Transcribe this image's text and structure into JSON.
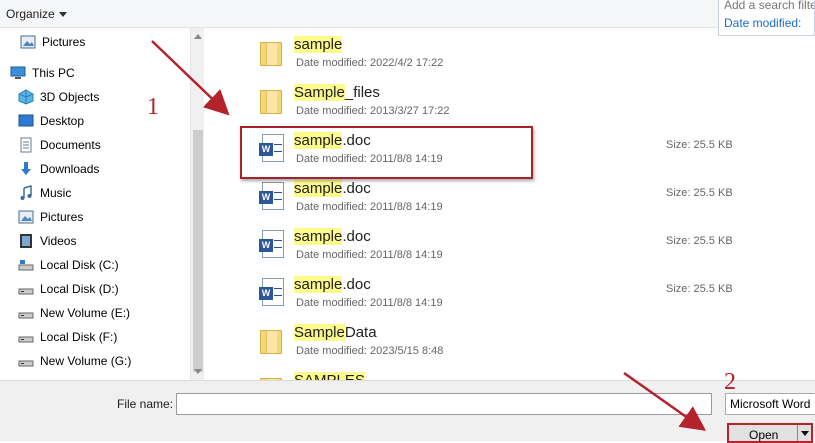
{
  "toolbar": {
    "organize_label": "Organize"
  },
  "search_dropdown": {
    "hint": "Add a search filte",
    "filter_label": "Date modified:"
  },
  "nav": {
    "items": [
      {
        "label": "Pictures",
        "icon": "pictures-icon"
      },
      {
        "label": "This PC",
        "icon": "computer-icon"
      },
      {
        "label": "3D Objects",
        "icon": "3d-objects-icon"
      },
      {
        "label": "Desktop",
        "icon": "desktop-icon"
      },
      {
        "label": "Documents",
        "icon": "documents-icon"
      },
      {
        "label": "Downloads",
        "icon": "downloads-icon"
      },
      {
        "label": "Music",
        "icon": "music-icon"
      },
      {
        "label": "Pictures",
        "icon": "pictures-icon"
      },
      {
        "label": "Videos",
        "icon": "videos-icon"
      },
      {
        "label": "Local Disk (C:)",
        "icon": "drive-icon"
      },
      {
        "label": "Local Disk (D:)",
        "icon": "drive-icon"
      },
      {
        "label": "New Volume (E:)",
        "icon": "drive-icon"
      },
      {
        "label": "Local Disk (F:)",
        "icon": "drive-icon"
      },
      {
        "label": "New Volume (G:)",
        "icon": "drive-icon"
      }
    ]
  },
  "files": [
    {
      "name_hl": "sample",
      "name_rest": "",
      "date": "Date modified: 2022/4/2 17:22",
      "size": "",
      "type": "folder"
    },
    {
      "name_hl": "Sample",
      "name_rest": "_files",
      "date": "Date modified: 2013/3/27 17:22",
      "size": "",
      "type": "folder"
    },
    {
      "name_hl": "sample",
      "name_rest": ".doc",
      "date": "Date modified: 2011/8/8 14:19",
      "size": "Size: 25.5 KB",
      "type": "word"
    },
    {
      "name_hl": "sample",
      "name_rest": ".doc",
      "date": "Date modified: 2011/8/8 14:19",
      "size": "Size: 25.5 KB",
      "type": "word"
    },
    {
      "name_hl": "sample",
      "name_rest": ".doc",
      "date": "Date modified: 2011/8/8 14:19",
      "size": "Size: 25.5 KB",
      "type": "word"
    },
    {
      "name_hl": "sample",
      "name_rest": ".doc",
      "date": "Date modified: 2011/8/8 14:19",
      "size": "Size: 25.5 KB",
      "type": "word"
    },
    {
      "name_hl": "Sample",
      "name_rest": "Data",
      "date": "Date modified: 2023/5/15 8:48",
      "size": "",
      "type": "folder"
    },
    {
      "name_hl": "SAMPLES",
      "name_rest": "",
      "date": "",
      "size": "",
      "type": "folder"
    }
  ],
  "bottom": {
    "file_name_label": "File name:",
    "file_name_value": "",
    "file_type": "Microsoft Word",
    "open_label": "Open"
  },
  "annotations": {
    "step1": "1",
    "step2": "2"
  },
  "colors": {
    "annotation_red": "#b4232b",
    "highlight_yellow": "#fdfb8c",
    "word_blue": "#2b579a"
  }
}
